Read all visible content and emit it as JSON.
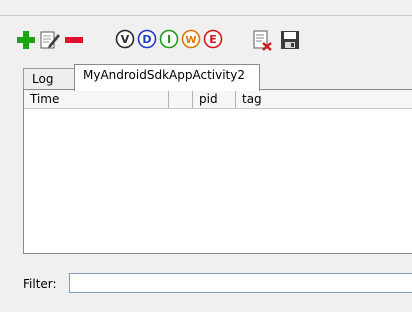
{
  "toolbar": {
    "buttons": [
      {
        "icon": "add-icon",
        "letter": ""
      },
      {
        "icon": "edit-icon",
        "letter": ""
      },
      {
        "icon": "remove-icon",
        "letter": ""
      },
      {
        "icon": "verbose-icon",
        "letter": "V",
        "color": "#2a2a2a"
      },
      {
        "icon": "debug-icon",
        "letter": "D",
        "color": "#1d3cc4"
      },
      {
        "icon": "info-icon",
        "letter": "I",
        "color": "#1f9a1f"
      },
      {
        "icon": "warning-icon",
        "letter": "W",
        "color": "#e07800"
      },
      {
        "icon": "error-icon",
        "letter": "E",
        "color": "#d01818"
      },
      {
        "icon": "clear-log-icon",
        "letter": ""
      },
      {
        "icon": "save-icon",
        "letter": ""
      }
    ]
  },
  "tabs": [
    {
      "label": "Log",
      "active": false
    },
    {
      "label": "MyAndroidSdkAppActivity2",
      "active": true
    }
  ],
  "table": {
    "columns": [
      "Time",
      "",
      "pid",
      "tag"
    ]
  },
  "filter": {
    "label": "Filter:",
    "value": ""
  },
  "colors": {
    "add": "#19a319",
    "remove": "#e0102a",
    "background": "#f0f0f0"
  }
}
